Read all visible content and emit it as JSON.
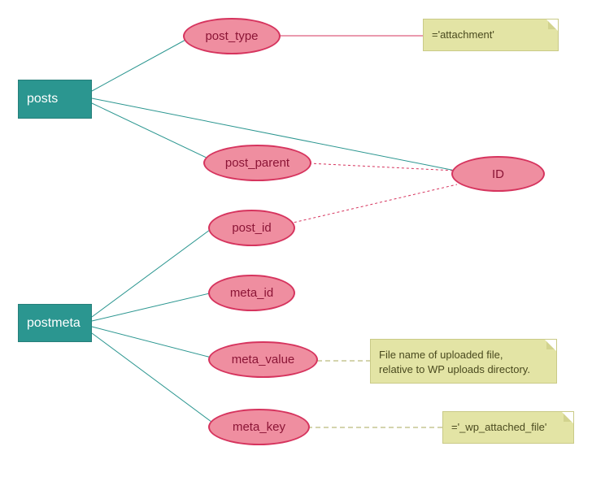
{
  "entities": {
    "posts": {
      "label": "posts"
    },
    "postmeta": {
      "label": "postmeta"
    }
  },
  "attributes": {
    "post_type": {
      "label": "post_type"
    },
    "post_parent": {
      "label": "post_parent"
    },
    "id": {
      "label": "ID"
    },
    "post_id": {
      "label": "post_id"
    },
    "meta_id": {
      "label": "meta_id"
    },
    "meta_value": {
      "label": "meta_value"
    },
    "meta_key": {
      "label": "meta_key"
    }
  },
  "notes": {
    "attachment": {
      "text": "='attachment'"
    },
    "filename": {
      "text": "File name of uploaded file,\nrelative to WP uploads directory."
    },
    "wp_attached": {
      "text": "='_wp_attached_file'"
    }
  }
}
